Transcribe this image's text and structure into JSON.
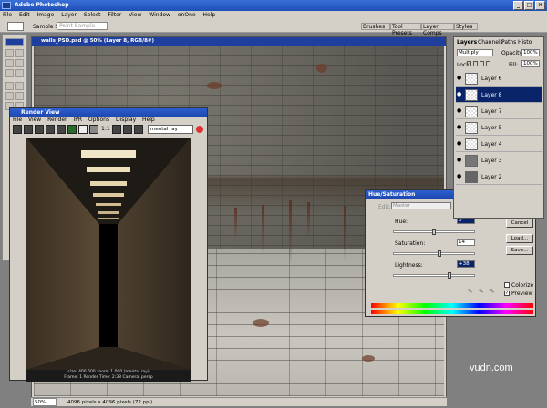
{
  "app": {
    "title": "Adobe Photoshop"
  },
  "menu": [
    "File",
    "Edit",
    "Image",
    "Layer",
    "Select",
    "Filter",
    "View",
    "Window",
    "onOne",
    "Help"
  ],
  "options": {
    "sample_label": "Sample Size:",
    "sample_value": "Point Sample"
  },
  "palette_tabs": [
    "Brushes",
    "Tool Presets",
    "Layer Comps",
    "Styles"
  ],
  "document": {
    "title": "walls_PSD.psd @ 50% (Layer 8, RGB/8#)",
    "zoom": "50%",
    "info": "4096 pixels x 4096 pixels (72 ppi)"
  },
  "render_view": {
    "title": "Render View",
    "menu": [
      "File",
      "View",
      "Render",
      "IPR",
      "Options",
      "Display",
      "Help"
    ],
    "renderer": "mental ray",
    "ratio": "1:1",
    "info_line1": "size: 400 600 zoom: 1.000 (mental ray)",
    "info_line2": "Frame: 1 Render Time: 2:38 Camera: persp"
  },
  "hue_sat": {
    "title": "Hue/Saturation",
    "edit_label": "Edit:",
    "edit_value": "Master",
    "hue_label": "Hue:",
    "hue_value": "0",
    "hue_fraction": 0.5,
    "sat_label": "Saturation:",
    "sat_value": "14",
    "sat_fraction": 0.57,
    "light_label": "Lightness:",
    "light_value": "+38",
    "light_fraction": 0.69,
    "ok": "OK",
    "cancel": "Cancel",
    "load": "Load...",
    "save": "Save...",
    "colorize": "Colorize",
    "preview": "Preview"
  },
  "layers": {
    "tabs": [
      "Layers",
      "Channels",
      "Paths",
      "Histo"
    ],
    "blend": "Multiply",
    "opacity_label": "Opacity:",
    "opacity": "100%",
    "lock_label": "Lock:",
    "fill_label": "Fill:",
    "fill": "100%",
    "items": [
      {
        "name": "Layer 6",
        "selected": false
      },
      {
        "name": "Layer 8",
        "selected": true
      },
      {
        "name": "Layer 7",
        "selected": false
      },
      {
        "name": "Layer 5",
        "selected": false
      },
      {
        "name": "Layer 4",
        "selected": false
      },
      {
        "name": "Layer 3",
        "selected": false
      },
      {
        "name": "Layer 2",
        "selected": false
      }
    ]
  },
  "watermark": "vudn.com"
}
